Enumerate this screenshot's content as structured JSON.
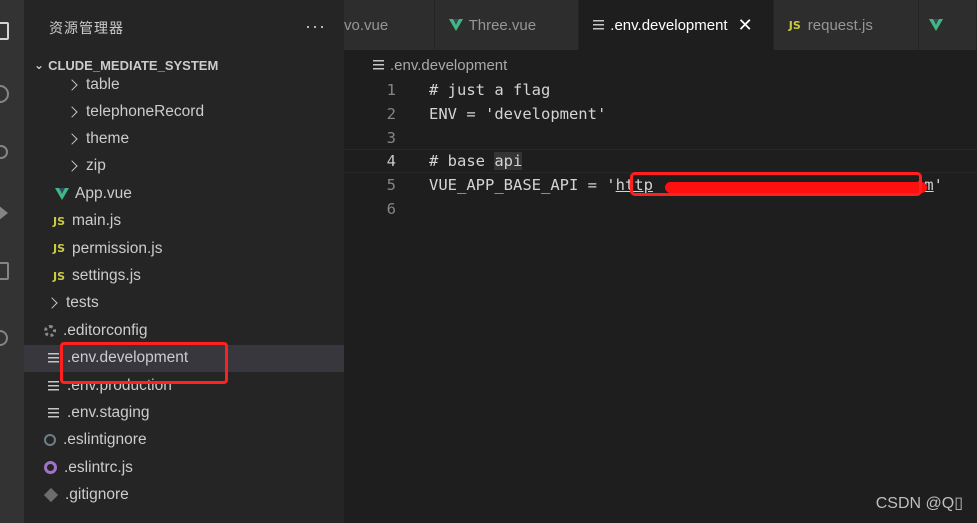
{
  "sidebar": {
    "title": "资源管理器",
    "more": "···",
    "project": "CLUDE_MEDIATE_SYSTEM",
    "items": [
      {
        "label": "table",
        "kind": "folder"
      },
      {
        "label": "telephoneRecord",
        "kind": "folder"
      },
      {
        "label": "theme",
        "kind": "folder"
      },
      {
        "label": "zip",
        "kind": "folder"
      },
      {
        "label": "App.vue",
        "kind": "vue"
      },
      {
        "label": "main.js",
        "kind": "js"
      },
      {
        "label": "permission.js",
        "kind": "js"
      },
      {
        "label": "settings.js",
        "kind": "js"
      },
      {
        "label": "tests",
        "kind": "folder"
      },
      {
        "label": ".editorconfig",
        "kind": "gear"
      },
      {
        "label": ".env.development",
        "kind": "lines",
        "selected": true
      },
      {
        "label": ".env.production",
        "kind": "lines"
      },
      {
        "label": ".env.staging",
        "kind": "lines"
      },
      {
        "label": ".eslintignore",
        "kind": "dot"
      },
      {
        "label": ".eslintrc.js",
        "kind": "eslint"
      },
      {
        "label": ".gitignore",
        "kind": "git"
      }
    ],
    "js_badge": "JS"
  },
  "tabs": [
    {
      "label": "vo.vue",
      "kind": "none"
    },
    {
      "label": "Three.vue",
      "kind": "vue"
    },
    {
      "label": ".env.development",
      "kind": "lines",
      "active": true,
      "close": "✕"
    },
    {
      "label": "request.js",
      "kind": "js"
    }
  ],
  "breadcrumb": ".env.development",
  "editor": {
    "lines": [
      {
        "n": "1",
        "text": "# just a flag"
      },
      {
        "n": "2",
        "text": "ENV = 'development'"
      },
      {
        "n": "3",
        "text": ""
      },
      {
        "n": "4",
        "text_a": "# base ",
        "text_b": "api",
        "current": true
      },
      {
        "n": "5",
        "text_a": "VUE_APP_BASE_API = '",
        "url_a": "http",
        "url_b": "om",
        "text_b": "'"
      },
      {
        "n": "6",
        "text": ""
      }
    ]
  },
  "watermark": "CSDN @Q▯",
  "colors": {
    "accent_red": "#ff2020",
    "vue_green": "#41b883",
    "js_yellow": "#cbcb41"
  }
}
